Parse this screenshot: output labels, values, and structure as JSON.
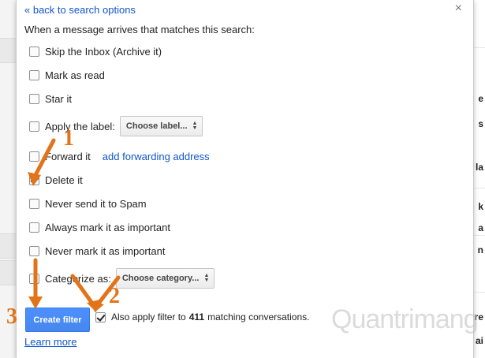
{
  "header": {
    "back_link": "« back to search options",
    "intro": "When a message arrives that matches this search:",
    "close": "×"
  },
  "options": [
    {
      "label": "Skip the Inbox (Archive it)",
      "checked": false
    },
    {
      "label": "Mark as read",
      "checked": false
    },
    {
      "label": "Star it",
      "checked": false
    },
    {
      "label": "Apply the label:",
      "checked": false,
      "select": "Choose label..."
    },
    {
      "label": "Forward it",
      "checked": false,
      "link": "add forwarding address"
    },
    {
      "label": "Delete it",
      "checked": true
    },
    {
      "label": "Never send it to Spam",
      "checked": false
    },
    {
      "label": "Always mark it as important",
      "checked": false
    },
    {
      "label": "Never mark it as important",
      "checked": false
    },
    {
      "label": "Categorize as:",
      "checked": false,
      "select": "Choose category..."
    }
  ],
  "footer": {
    "create_button": "Create filter",
    "apply_prefix": "Also apply filter to",
    "apply_count": "411",
    "apply_suffix": "matching conversations.",
    "apply_checked": true,
    "learn_more": "Learn more"
  },
  "annotations": [
    "1",
    "2",
    "3"
  ],
  "watermark": "Quantrimang",
  "background_right_letters": [
    "e",
    "s",
    "la",
    "k",
    "a",
    "n",
    "re",
    "ai"
  ],
  "colors": {
    "link": "#1155cc",
    "button": "#4d90fe",
    "annotation": "#e37318"
  }
}
